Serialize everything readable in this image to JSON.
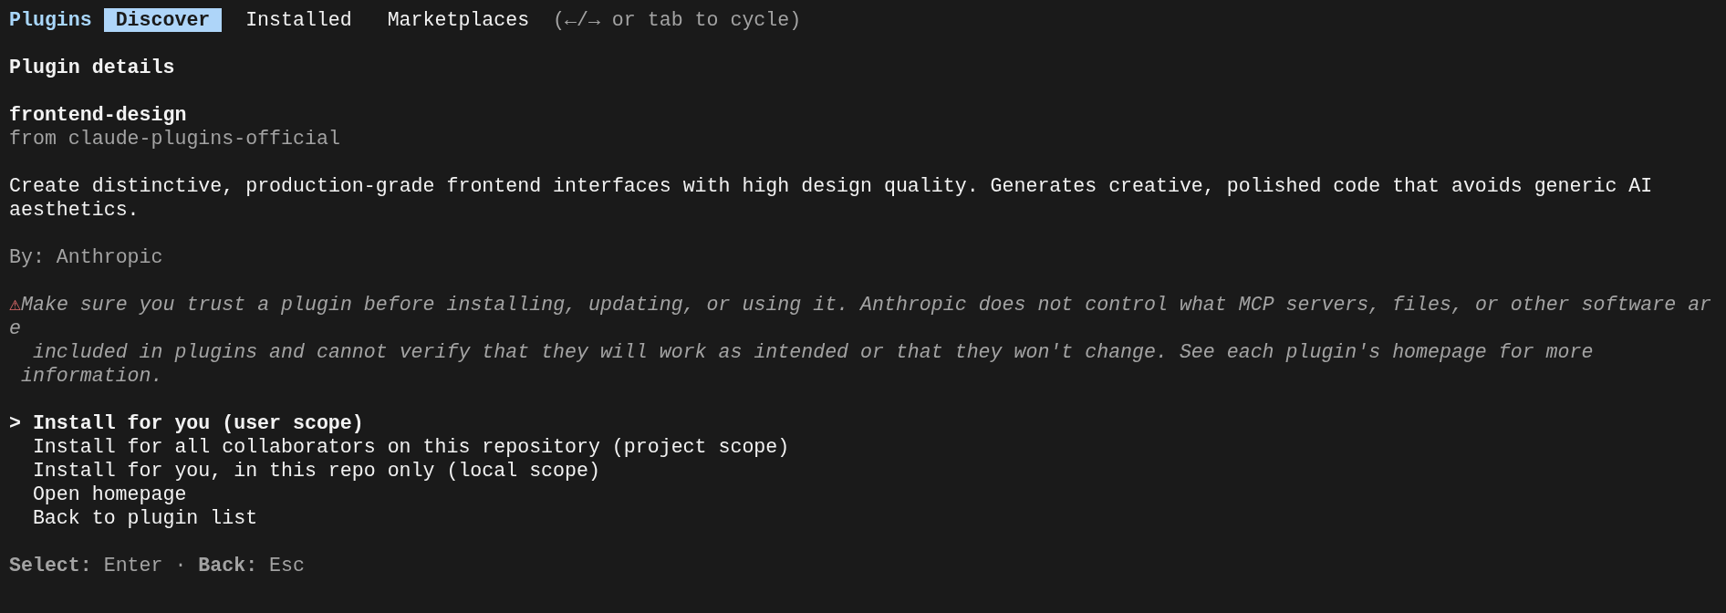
{
  "header": {
    "title": "Plugins",
    "tabs": [
      {
        "label": "Discover",
        "selected": true
      },
      {
        "label": "Installed",
        "selected": false
      },
      {
        "label": "Marketplaces",
        "selected": false
      }
    ],
    "hint": "(←/→ or tab to cycle)"
  },
  "heading": "Plugin details",
  "plugin": {
    "name": "frontend-design",
    "source": "from claude-plugins-official",
    "description": "Create distinctive, production-grade frontend interfaces with high design quality. Generates creative, polished code that avoids generic AI aesthetics.",
    "author": "By: Anthropic"
  },
  "warning": {
    "icon": "⚠",
    "lines": [
      "Make sure you trust a plugin before installing, updating, or using it. Anthropic does not control what MCP servers, files, or other software ar",
      "e",
      "  included in plugins and cannot verify that they will work as intended or that they won't change. See each plugin's homepage for more",
      " information."
    ]
  },
  "options": {
    "pointer": ">",
    "items": [
      {
        "label": "Install for you (user scope)",
        "selected": true
      },
      {
        "label": "Install for all collaborators on this repository (project scope)",
        "selected": false
      },
      {
        "label": "Install for you, in this repo only (local scope)",
        "selected": false
      },
      {
        "label": "Open homepage",
        "selected": false
      },
      {
        "label": "Back to plugin list",
        "selected": false
      }
    ]
  },
  "footer": "**Select:** Enter · **Back:** Esc"
}
